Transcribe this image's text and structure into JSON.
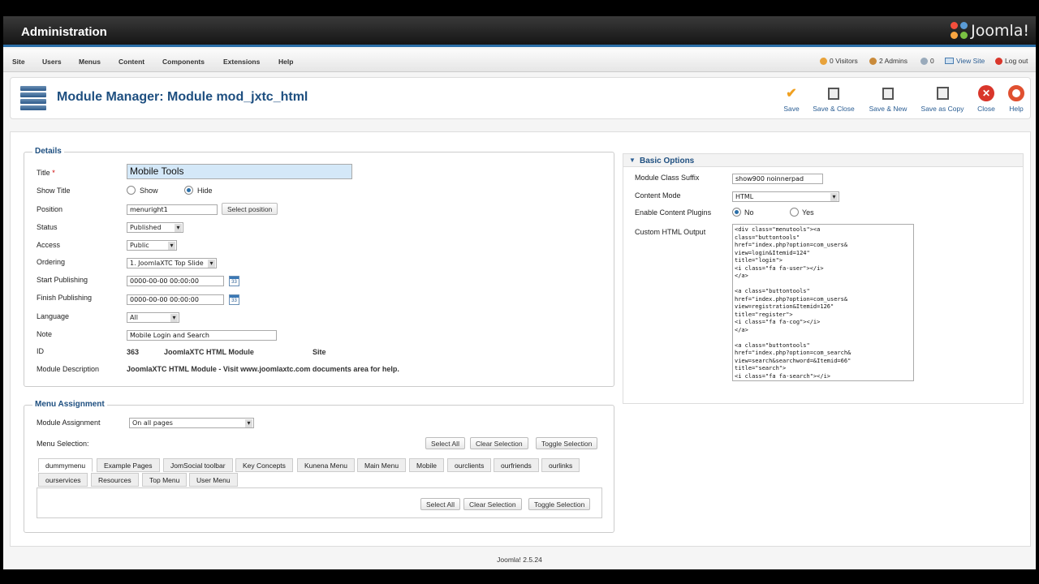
{
  "header": {
    "title": "Administration",
    "logo_text": "Joomla!"
  },
  "menubar": {
    "items": [
      "Site",
      "Users",
      "Menus",
      "Content",
      "Components",
      "Extensions",
      "Help"
    ],
    "visitors": "0 Visitors",
    "admins": "2 Admins",
    "messages": "0",
    "view_site": "View Site",
    "logout": "Log out"
  },
  "toolbar": {
    "page_title": "Module Manager: Module mod_jxtc_html",
    "buttons": [
      "Save",
      "Save & Close",
      "Save & New",
      "Save as Copy",
      "Close",
      "Help"
    ]
  },
  "details": {
    "legend": "Details",
    "title_label": "Title",
    "title_required": "*",
    "title_value": "Mobile Tools",
    "show_title_label": "Show Title",
    "show_label": "Show",
    "hide_label": "Hide",
    "position_label": "Position",
    "position_value": "menuright1",
    "select_position": "Select position",
    "status_label": "Status",
    "status_value": "Published",
    "access_label": "Access",
    "access_value": "Public",
    "ordering_label": "Ordering",
    "ordering_value": "1. JoomlaXTC Top Slide",
    "start_label": "Start Publishing",
    "start_value": "0000-00-00 00:00:00",
    "finish_label": "Finish Publishing",
    "finish_value": "0000-00-00 00:00:00",
    "cal_label": "33",
    "language_label": "Language",
    "language_value": "All",
    "note_label": "Note",
    "note_value": "Mobile Login and Search",
    "id_label": "ID",
    "id_value": "363",
    "module_type": "JoomlaXTC HTML Module",
    "client": "Site",
    "desc_label": "Module Description",
    "desc_value": "JoomlaXTC HTML Module - Visit www.joomlaxtc.com documents area for help."
  },
  "menu_assignment": {
    "legend": "Menu Assignment",
    "assignment_label": "Module Assignment",
    "assignment_value": "On all pages",
    "selection_label": "Menu Selection:",
    "select_all": "Select All",
    "clear_selection": "Clear Selection",
    "toggle_selection": "Toggle Selection",
    "tabs_row1": [
      "dummymenu",
      "Example Pages",
      "JomSocial toolbar",
      "Key Concepts",
      "Kunena Menu",
      "Main Menu",
      "Mobile",
      "ourclients",
      "ourfriends",
      "ourlinks"
    ],
    "tabs_row2": [
      "ourservices",
      "Resources",
      "Top Menu",
      "User Menu"
    ]
  },
  "basic_options": {
    "title": "Basic Options",
    "suffix_label": "Module Class Suffix",
    "suffix_value": "show900 noinnerpad",
    "mode_label": "Content Mode",
    "mode_value": "HTML",
    "plugins_label": "Enable Content Plugins",
    "no_label": "No",
    "yes_label": "Yes",
    "custom_label": "Custom HTML Output",
    "custom_value": "<div class=\"menutools\"><a\nclass=\"buttontools\"\nhref=\"index.php?option=com_users&\nview=login&Itemid=124\"\ntitle=\"login\">\n<i class=\"fa fa-user\"></i>\n</a>\n\n<a class=\"buttontools\"\nhref=\"index.php?option=com_users&\nview=registration&Itemid=126\"\ntitle=\"register\">\n<i class=\"fa fa-cog\"></i>\n</a>\n\n<a class=\"buttontools\"\nhref=\"index.php?option=com_search&\nview=search&searchword=&Itemid=66\"\ntitle=\"search\">\n<i class=\"fa fa-search\"></i>"
  },
  "footer": {
    "version": "Joomla! 2.5.24"
  },
  "colors": {
    "accent": "#2b6fa8",
    "title_blue": "#1e4f80",
    "save_orange": "#f0a020",
    "close_red": "#d9362b"
  }
}
